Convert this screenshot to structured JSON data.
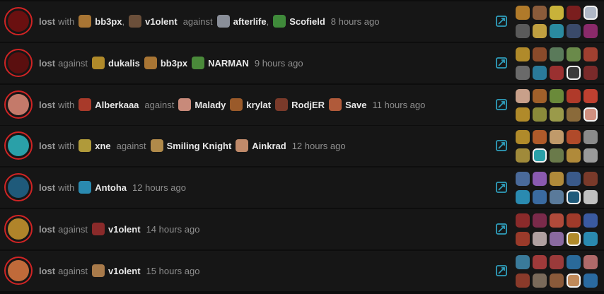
{
  "colors": {
    "loss_ring": "#d02424",
    "background": "#0d0d0d",
    "row": "#161616",
    "link_icon": "#2f9fbd"
  },
  "matches": [
    {
      "avatar": "#6a1010",
      "result": "lost",
      "segments": [
        {
          "type": "text",
          "text": "with"
        },
        {
          "type": "player",
          "name": "bb3px",
          "color": "#a87534",
          "sep": ","
        },
        {
          "type": "player",
          "name": "v1olent",
          "color": "#6b4f3a"
        },
        {
          "type": "text",
          "text": "against"
        },
        {
          "type": "player",
          "name": "afterlife",
          "color": "#8a8f99",
          "sep": ","
        },
        {
          "type": "player",
          "name": "Scofield",
          "color": "#3f8a3a"
        }
      ],
      "time": "8 hours ago",
      "heroes": [
        "#b07a2a",
        "#8a5b3a",
        "#c8b23a",
        "#7a1e1e",
        "#b0b8c6",
        "#5a5a5a",
        "#c0a040",
        "#2a8aa0",
        "#3a4a6a",
        "#8a2a6a"
      ],
      "self": 4
    },
    {
      "avatar": "#5a0f0f",
      "result": "lost",
      "segments": [
        {
          "type": "text",
          "text": "against"
        },
        {
          "type": "player",
          "name": "dukalis",
          "color": "#b08a2a"
        },
        {
          "type": "player",
          "name": "bb3px",
          "color": "#a87534"
        },
        {
          "type": "player",
          "name": "NARMAN",
          "color": "#4a8a3a"
        }
      ],
      "time": "9 hours ago",
      "heroes": [
        "#b08a2a",
        "#8a4a2a",
        "#5a7a5a",
        "#6a8a4a",
        "#a04030",
        "#6a6a6a",
        "#2a7a9a",
        "#9a3030",
        "#3a3a3a",
        "#7a2a2a"
      ],
      "self": 8
    },
    {
      "avatar": "#c47a6a",
      "result": "lost",
      "segments": [
        {
          "type": "text",
          "text": "with"
        },
        {
          "type": "player",
          "name": "Alberkaaa",
          "color": "#a83a2a"
        },
        {
          "type": "text",
          "text": "against"
        },
        {
          "type": "player",
          "name": "Malady",
          "color": "#c88a7a"
        },
        {
          "type": "player",
          "name": "krylat",
          "color": "#9a5a2a"
        },
        {
          "type": "player",
          "name": "RodjER",
          "color": "#7a3a2a"
        },
        {
          "type": "player",
          "name": "Save",
          "color": "#b05a3a"
        }
      ],
      "time": "11 hours ago",
      "heroes": [
        "#c8a08a",
        "#a0602a",
        "#6a8a3a",
        "#b03a2a",
        "#c04030",
        "#b08a2a",
        "#8a8a3a",
        "#9a9a4a",
        "#8a6a3a",
        "#d09080"
      ],
      "self": 9
    },
    {
      "avatar": "#2aa0a8",
      "result": "lost",
      "segments": [
        {
          "type": "text",
          "text": "with"
        },
        {
          "type": "player",
          "name": "xne",
          "color": "#b09a3a"
        },
        {
          "type": "text",
          "text": "against"
        },
        {
          "type": "player",
          "name": "Smiling Knight",
          "color": "#b08a4a"
        },
        {
          "type": "player",
          "name": "Ainkrad",
          "color": "#c08a6a"
        }
      ],
      "time": "12 hours ago",
      "heroes": [
        "#b08a2a",
        "#b05a2a",
        "#c09a6a",
        "#b04a2a",
        "#8a8a8a",
        "#a08a3a",
        "#2aa0a8",
        "#6a7a4a",
        "#b08a3a",
        "#9a9a9a"
      ],
      "self": 6
    },
    {
      "avatar": "#1f5a7a",
      "result": "lost",
      "segments": [
        {
          "type": "text",
          "text": "with"
        },
        {
          "type": "player",
          "name": "Antoha",
          "color": "#2a8ab0"
        }
      ],
      "time": "12 hours ago",
      "heroes": [
        "#4a6a9a",
        "#8a5ab0",
        "#b08a3a",
        "#3a5a8a",
        "#7a3a2a",
        "#2a8ab0",
        "#3a6aa0",
        "#5a7a9a",
        "#1f5a7a",
        "#c0c0c0"
      ],
      "self": 8
    },
    {
      "avatar": "#b0842a",
      "result": "lost",
      "segments": [
        {
          "type": "text",
          "text": "against"
        },
        {
          "type": "player",
          "name": "v1olent",
          "color": "#8a2a2a"
        }
      ],
      "time": "14 hours ago",
      "heroes": [
        "#8a2a2a",
        "#7a2a4a",
        "#b04a3a",
        "#a03a2a",
        "#3a5aa0",
        "#9a3a2a",
        "#b0a0a0",
        "#8a6aa0",
        "#b08a2a",
        "#2a8ab0"
      ],
      "self": 8
    },
    {
      "avatar": "#c06a3a",
      "result": "lost",
      "segments": [
        {
          "type": "text",
          "text": "against"
        },
        {
          "type": "player",
          "name": "v1olent",
          "color": "#a87a4a"
        }
      ],
      "time": "15 hours ago",
      "heroes": [
        "#3a7a9a",
        "#a03a3a",
        "#9a3a3a",
        "#2a6a9a",
        "#b06a6a",
        "#8a3a2a",
        "#7a6a5a",
        "#8a5a3a",
        "#c08a5a",
        "#2a6aa0"
      ],
      "self": 8
    }
  ]
}
